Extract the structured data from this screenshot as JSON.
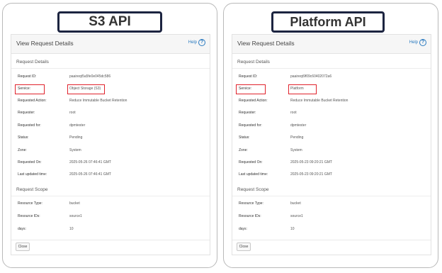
{
  "left": {
    "api_label": "S3 API",
    "panel_title": "View Request Details",
    "help_label": "Help",
    "help_symbol": "?",
    "section_details": "Request Details",
    "details": [
      {
        "label": "Request ID:",
        "value": "paaireqt5a5fe0e045dc586"
      },
      {
        "label": "Service:",
        "value": "Object Storage (S3)"
      },
      {
        "label": "Requested Action:",
        "value": "Reduce Immutable Bucket Retention"
      },
      {
        "label": "Requester:",
        "value": "root"
      },
      {
        "label": "Requested for:",
        "value": "dpmtester"
      },
      {
        "label": "Status:",
        "value": "Pending"
      },
      {
        "label": "Zone:",
        "value": "System"
      },
      {
        "label": "Requested On:",
        "value": "2025-05-26 07:46:41 GMT"
      },
      {
        "label": "Last updated time:",
        "value": "2025-05-26 07:46:41 GMT"
      }
    ],
    "section_scope": "Request Scope",
    "scope": [
      {
        "label": "Resource Type:",
        "value": "bucket"
      },
      {
        "label": "Resource IDs:",
        "value": "source1"
      },
      {
        "label": "days:",
        "value": "10"
      }
    ],
    "close_label": "Close"
  },
  "right": {
    "api_label": "Platform API",
    "panel_title": "View Request Details",
    "help_label": "Help",
    "help_symbol": "?",
    "section_details": "Request Details",
    "details": [
      {
        "label": "Request ID:",
        "value": "paaireqt9f09c60402072a6"
      },
      {
        "label": "Service:",
        "value": "Platform"
      },
      {
        "label": "Requested Action:",
        "value": "Reduce Immutable Bucket Retention"
      },
      {
        "label": "Requester:",
        "value": "root"
      },
      {
        "label": "Requested for:",
        "value": "dpmtester"
      },
      {
        "label": "Status:",
        "value": "Pending"
      },
      {
        "label": "Zone:",
        "value": "System"
      },
      {
        "label": "Requested On:",
        "value": "2025-05-23 09:20:21 GMT"
      },
      {
        "label": "Last updated time:",
        "value": "2025-05-23 09:20:21 GMT"
      }
    ],
    "section_scope": "Request Scope",
    "scope": [
      {
        "label": "Resource Type:",
        "value": "bucket"
      },
      {
        "label": "Resource IDs:",
        "value": "source1"
      },
      {
        "label": "days:",
        "value": "10"
      }
    ],
    "close_label": "Close"
  },
  "colors": {
    "highlight": "#e0222c",
    "title_border": "#1c2440",
    "link": "#2a7ac0"
  }
}
